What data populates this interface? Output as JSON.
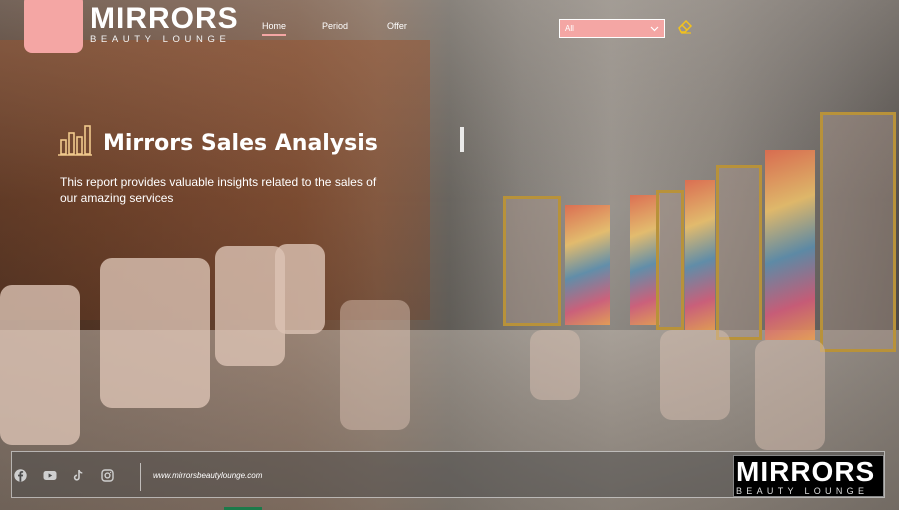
{
  "brand": {
    "name": "MIRRORS",
    "subtitle": "BEAUTY LOUNGE",
    "accent_color": "#f4a6a4"
  },
  "nav": {
    "items": [
      {
        "label": "Home",
        "active": true
      },
      {
        "label": "Period"
      },
      {
        "label": "Offer"
      }
    ]
  },
  "filter": {
    "selected": "All"
  },
  "hero": {
    "title": "Mirrors Sales Analysis",
    "description": "This report provides valuable insights related  to the sales of our amazing services"
  },
  "footer": {
    "website": "www.mirrorsbeautylounge.com",
    "social_icons": [
      "facebook-icon",
      "youtube-icon",
      "tiktok-icon",
      "instagram-icon"
    ],
    "logo_name": "MIRRORS",
    "logo_subtitle": "BEAUTY LOUNGE"
  }
}
